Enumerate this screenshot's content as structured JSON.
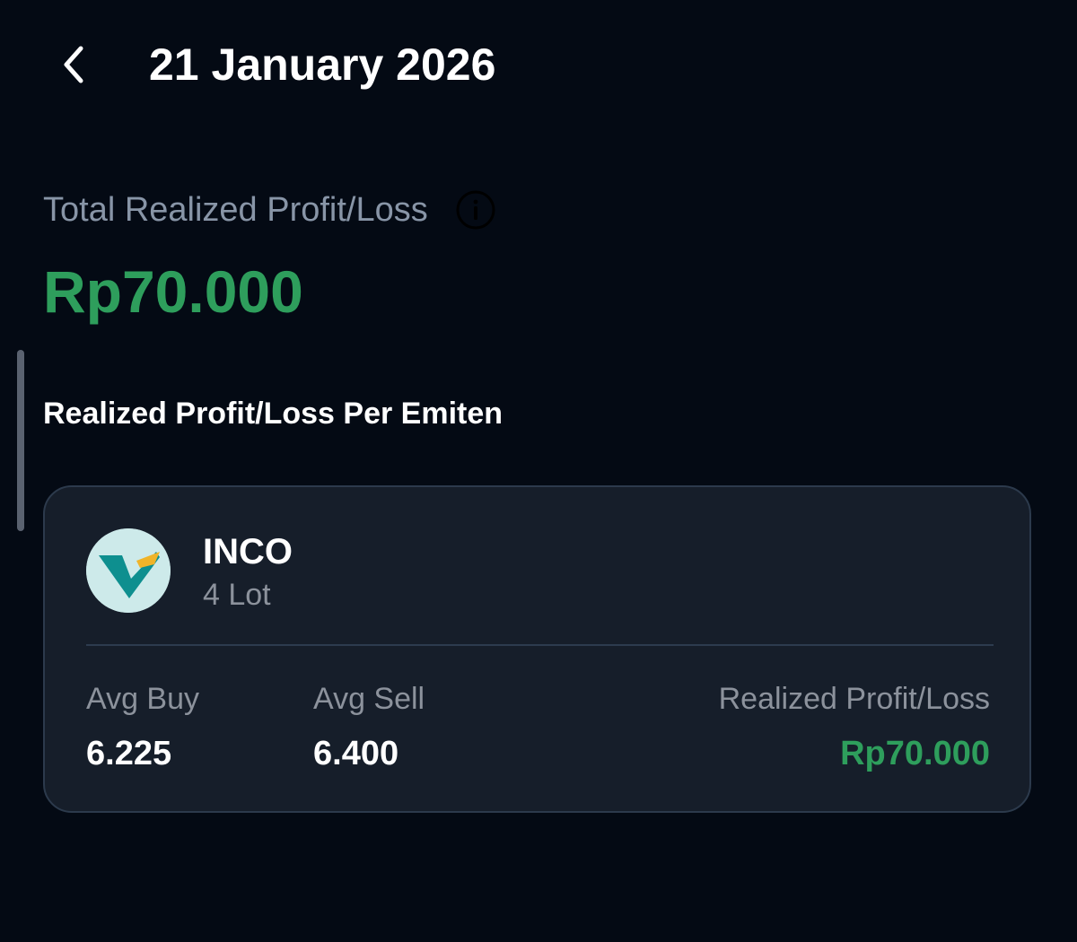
{
  "header": {
    "back_icon": "chevron-left-icon",
    "title": "21 January 2026"
  },
  "summary": {
    "label": "Total Realized Profit/Loss",
    "info_icon": "info-icon",
    "value": "Rp70.000"
  },
  "section": {
    "title": "Realized Profit/Loss Per Emiten"
  },
  "items": [
    {
      "ticker": "INCO",
      "lot": "4 Lot",
      "logo_icon": "inco-logo",
      "avg_buy_label": "Avg Buy",
      "avg_buy": "6.225",
      "avg_sell_label": "Avg Sell",
      "avg_sell": "6.400",
      "pl_label": "Realized Profit/Loss",
      "pl_value": "Rp70.000"
    }
  ],
  "colors": {
    "background": "#040a14",
    "card": "#161e2a",
    "profit_green": "#2e9e5c",
    "muted_text": "#8c929c",
    "logo_teal": "#0e8f8f",
    "logo_gold": "#f0b429"
  }
}
